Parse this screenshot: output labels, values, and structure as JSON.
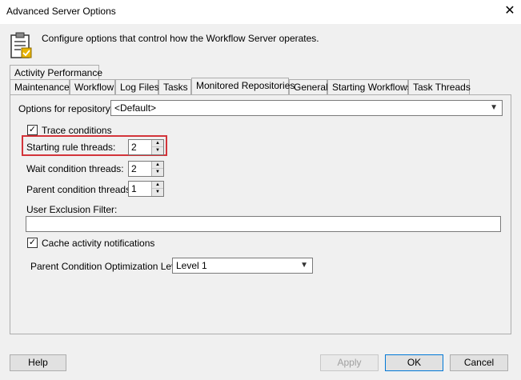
{
  "window": {
    "title": "Advanced Server Options",
    "description": "Configure options that control how the Workflow Server operates."
  },
  "tabs_row1": [
    {
      "label": "Activity Performance"
    }
  ],
  "tabs_row2": [
    {
      "label": "Maintenance"
    },
    {
      "label": "Workflow"
    },
    {
      "label": "Log Files"
    },
    {
      "label": "Tasks"
    },
    {
      "label": "Monitored Repositories",
      "active": true
    },
    {
      "label": "General"
    },
    {
      "label": "Starting Workflows"
    },
    {
      "label": "Task Threads"
    }
  ],
  "panel": {
    "repository_label": "Options for repository:",
    "repository_value": "<Default>",
    "trace_conditions": {
      "label": "Trace conditions",
      "checked": true
    },
    "starting_rule_threads": {
      "label": "Starting rule threads:",
      "value": "2"
    },
    "wait_condition_threads": {
      "label": "Wait condition threads:",
      "value": "2"
    },
    "parent_condition_threads": {
      "label": "Parent condition threads:",
      "value": "1"
    },
    "user_exclusion_label": "User Exclusion Filter:",
    "user_exclusion_value": "",
    "cache_activity": {
      "label": "Cache activity notifications",
      "checked": true
    },
    "optimization_label": "Parent Condition Optimization Level:",
    "optimization_value": "Level 1"
  },
  "buttons": {
    "help": "Help",
    "apply": "Apply",
    "ok": "OK",
    "cancel": "Cancel"
  },
  "colors": {
    "highlight": "#d3343a",
    "default_button_border": "#0078d7"
  }
}
